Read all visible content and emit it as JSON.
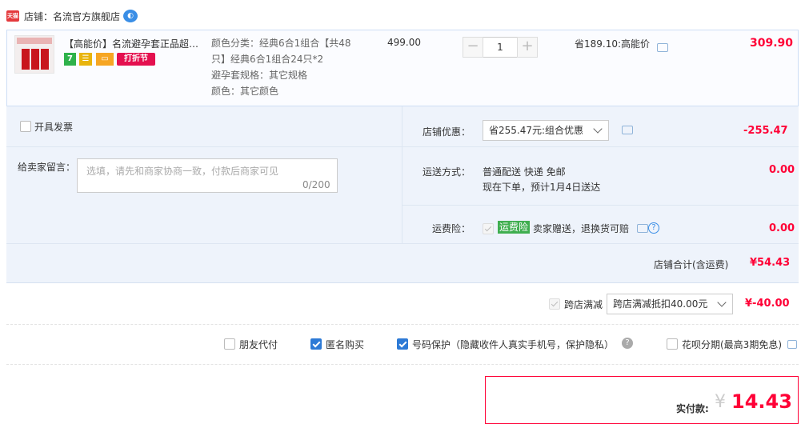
{
  "shop": {
    "badge": "天猫",
    "label": "店铺：名流官方旗舰店",
    "wangwang": "◐"
  },
  "item": {
    "title": "【高能价】名流避孕套正品超薄...",
    "tags": {
      "t1": "7",
      "t2": "☰",
      "t3": "▭",
      "t4": "打折节"
    },
    "sku_lines": [
      "颜色分类：经典6合1组合【共48",
      "只】经典6合1组合24只*2",
      "避孕套规格：其它规格",
      "颜色：其它颜色"
    ],
    "price": "499.00",
    "qty_minus": "−",
    "qty": "1",
    "qty_plus": "+",
    "promo": "省189.10:高能价",
    "total": "309.90"
  },
  "invoice": {
    "label": "开具发票",
    "checked": false
  },
  "message": {
    "label": "给卖家留言：",
    "placeholder": "选填，请先和商家协商一致，付款后商家可见",
    "count": "0/200"
  },
  "discount": {
    "label": "店铺优惠：",
    "selected": "省255.47元:组合优惠",
    "amount": "-255.47"
  },
  "shipping": {
    "label": "运送方式：",
    "line1": "普通配送 快递 免邮",
    "line2": "现在下单，预计1月4日送达",
    "amount": "0.00"
  },
  "insurance": {
    "label": "运费险：",
    "badge": "运费险",
    "text": "卖家赠送，退换货可赔",
    "help": "?",
    "amount": "0.00"
  },
  "shop_total": {
    "label": "店铺合计(含运费)",
    "amount": "¥54.43"
  },
  "cross_store": {
    "label": "跨店满减",
    "selected": "跨店满减抵扣40.00元",
    "amount": "¥-40.00"
  },
  "options": {
    "friend_pay": "朋友代付",
    "anonymous": "匿名购买",
    "phone_protect": "号码保护（隐藏收件人真实手机号，保护隐私）",
    "help": "?",
    "huabei": "花呗分期(最高3期免息)"
  },
  "pay": {
    "label": "实付款:",
    "currency": "¥",
    "amount": "14.43"
  },
  "colors": {
    "accent": "#ff0036",
    "panel": "#eef3fb",
    "blue": "#2d7ad6"
  }
}
